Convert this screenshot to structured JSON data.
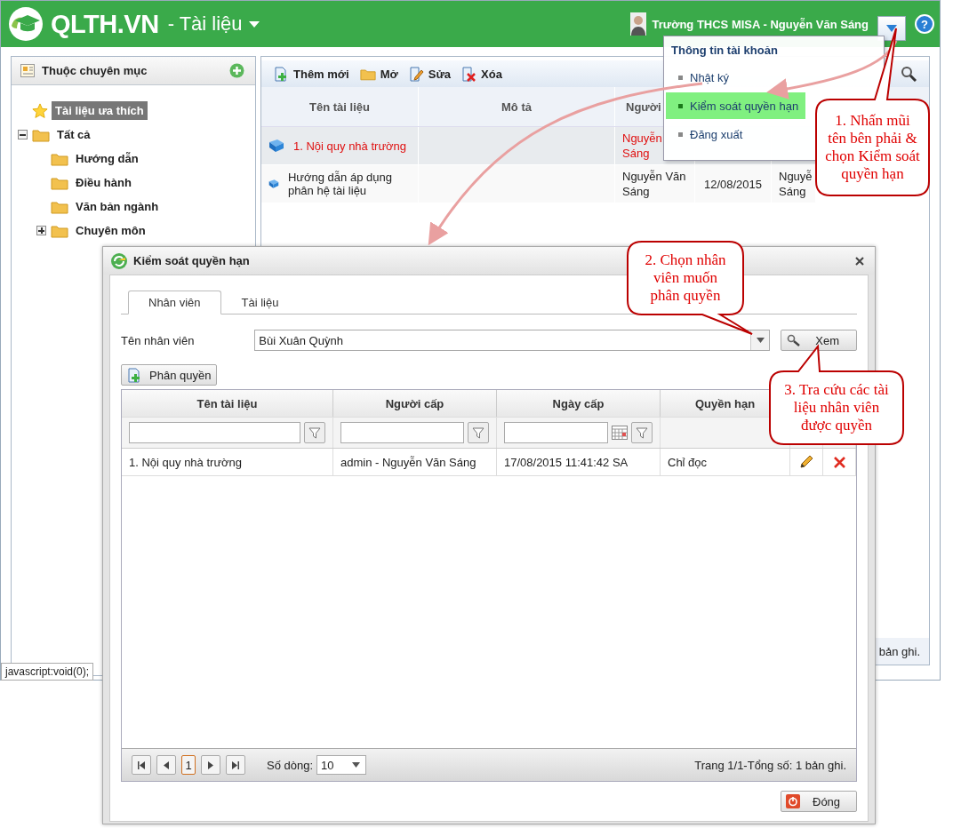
{
  "header": {
    "logo": "QLTH.VN",
    "module": "- Tài liệu",
    "user": "Trường THCS MISA - Nguyễn Văn Sáng",
    "help": "?"
  },
  "account_menu": {
    "title": "Thông tin tài khoản",
    "items": [
      {
        "label": "Nhật ký",
        "selected": false
      },
      {
        "label": "Kiểm soát quyền hạn",
        "selected": true
      },
      {
        "label": "Đăng xuất",
        "selected": false
      }
    ]
  },
  "sidebar": {
    "title": "Thuộc chuyên mục",
    "tree": [
      {
        "label": "Tài liệu ưa thích",
        "kind": "favorite",
        "selected": true
      },
      {
        "label": "Tất cả",
        "kind": "folder",
        "selected": false,
        "expanded": true,
        "children": [
          {
            "label": "Hướng dẫn",
            "kind": "folder",
            "selected": false
          },
          {
            "label": "Điều hành",
            "kind": "folder",
            "selected": false
          },
          {
            "label": "Văn bản ngành",
            "kind": "folder",
            "selected": false
          },
          {
            "label": "Chuyên môn",
            "kind": "folder",
            "selected": false,
            "expanded": false
          }
        ]
      }
    ]
  },
  "toolbar": [
    {
      "label": "Thêm mới",
      "kind": "add"
    },
    {
      "label": "Mở",
      "kind": "open"
    },
    {
      "label": "Sửa",
      "kind": "edit"
    },
    {
      "label": "Xóa",
      "kind": "delete"
    }
  ],
  "documents": {
    "columns": [
      "Tên tài liệu",
      "Mô tả",
      "Người"
    ],
    "rows": [
      {
        "selected": true,
        "name": "1. Nội quy nhà trường",
        "person": "Nguyễn\nSáng"
      },
      {
        "selected": false,
        "name": "Hướng dẫn áp dụng phân hệ tài liệu",
        "person": "Nguyễn Văn\nSáng",
        "date": "12/08/2015",
        "column_5": "Nguyễ\nSáng"
      }
    ],
    "footer": "bản ghi."
  },
  "status_tip": "javascript:void(0);",
  "dialog": {
    "title": "Kiểm soát quyền hạn",
    "tabs": [
      {
        "label": "Nhân viên",
        "selected": true
      },
      {
        "label": "Tài liệu",
        "selected": false
      }
    ],
    "employee_label": "Tên nhân viên",
    "employee_value": "Bùi Xuân Quỳnh",
    "view_button": "Xem",
    "grant_button": "Phân quyền",
    "grid": {
      "columns": [
        "Tên tài liệu",
        "Người cấp",
        "Ngày cấp",
        "Quyền hạn"
      ],
      "rows": [
        {
          "cells": [
            "1. Nội quy nhà trường",
            "admin - Nguyễn Văn Sáng",
            "17/08/2015 11:41:42 SA",
            "Chỉ đọc"
          ]
        }
      ]
    },
    "pager": {
      "page": "1",
      "rows_label": "Số dòng:",
      "rows_value": "10",
      "summary": "Trang 1/1-Tổng số: 1 bản ghi."
    },
    "close_button": "Đóng"
  },
  "callouts": [
    {
      "text": "1. Nhấn mũi tên bên phải & chọn Kiểm soát quyền hạn"
    },
    {
      "text": "2. Chọn nhân viên muốn phân quyền"
    },
    {
      "text": "3. Tra cứu các tài liệu nhân viên được quyền"
    }
  ]
}
